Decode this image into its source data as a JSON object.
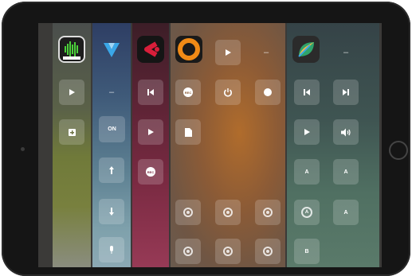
{
  "device": {
    "name": "iPad"
  },
  "controls": {
    "dash": "–",
    "on": "ON",
    "rec": "REC",
    "a": "A",
    "a_sub": "A",
    "b": "B"
  },
  "icons": {
    "play": "play-icon",
    "skip_back": "skip-back-icon",
    "skip_forward": "skip-forward-icon",
    "add_file": "add-file-icon",
    "file": "file-icon",
    "up": "arrow-up-icon",
    "down": "arrow-down-icon",
    "volume": "volume-icon",
    "power": "power-icon"
  },
  "colors": {
    "accent_waveform": "#4bd03a",
    "accent_blue": "#3aa7e8",
    "accent_red": "#d81e3a",
    "accent_orange": "#f08a16"
  }
}
